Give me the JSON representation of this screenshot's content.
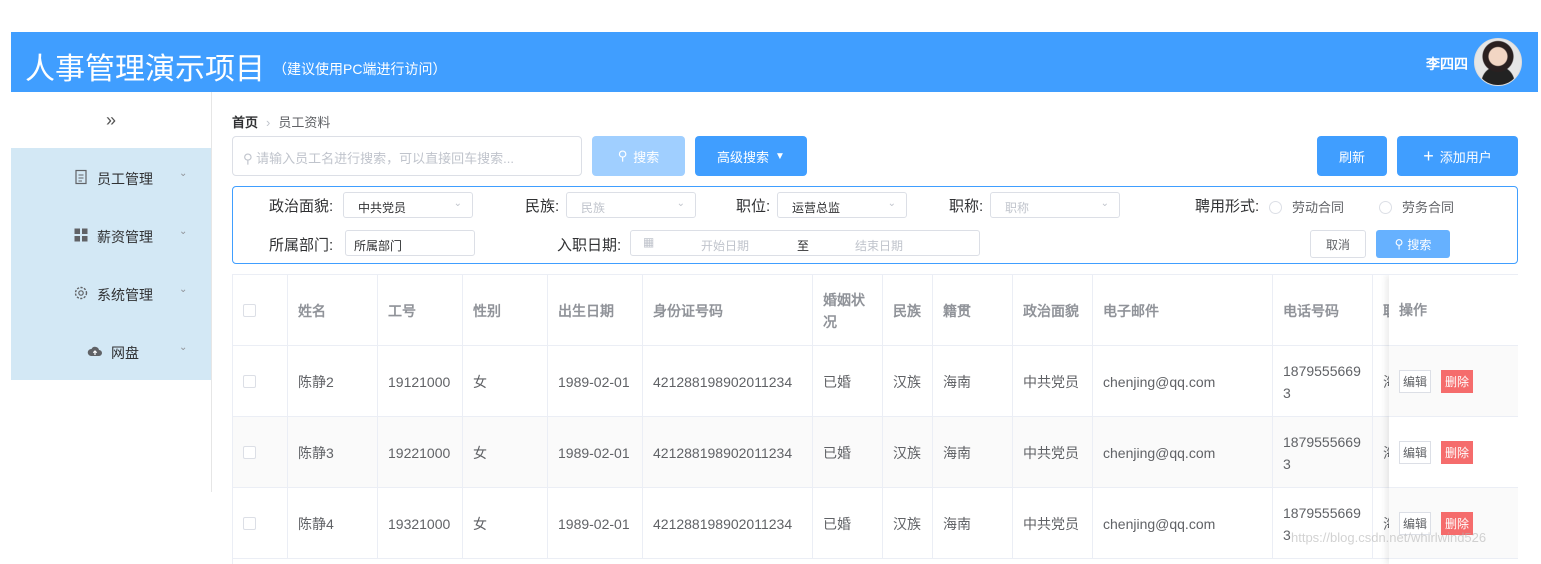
{
  "header": {
    "title": "人事管理演示项目",
    "subtitle": "（建议使用PC端进行访问）",
    "user_name": "李四四",
    "background_color": "#409eff"
  },
  "sidebar": {
    "collapse_icon": "»",
    "items": [
      {
        "label": "员工管理",
        "icon": "document-icon"
      },
      {
        "label": "薪资管理",
        "icon": "grid-icon"
      },
      {
        "label": "系统管理",
        "icon": "gear-icon"
      },
      {
        "label": "网盘",
        "icon": "cloud-upload-icon"
      }
    ]
  },
  "breadcrumb": {
    "home": "首页",
    "current": "员工资料"
  },
  "toolbar": {
    "search_placeholder": "请输入员工名进行搜索，可以直接回车搜索...",
    "search_label": "搜索",
    "advanced_label": "高级搜索",
    "refresh_label": "刷新",
    "add_user_label": "添加用户"
  },
  "filters": {
    "political_label": "政治面貌:",
    "political_value": "中共党员",
    "nation_label": "民族:",
    "nation_placeholder": "民族",
    "position_label": "职位:",
    "position_value": "运营总监",
    "title_label": "职称:",
    "title_placeholder": "职称",
    "hire_type_label": "聘用形式:",
    "hire_option_1": "劳动合同",
    "hire_option_2": "劳务合同",
    "department_label": "所属部门:",
    "department_placeholder": "所属部门",
    "hire_date_label": "入职日期:",
    "start_date_placeholder": "开始日期",
    "range_separator": "至",
    "end_date_placeholder": "结束日期",
    "cancel_label": "取消",
    "search_label": "搜索"
  },
  "table": {
    "columns": [
      "姓名",
      "工号",
      "性别",
      "出生日期",
      "身份证号码",
      "婚姻状况",
      "民族",
      "籍贯",
      "政治面貌",
      "电子邮件",
      "电话号码",
      "职"
    ],
    "operation_header": "操作",
    "edit_label": "编辑",
    "delete_label": "删除",
    "rows": [
      {
        "name": "陈静2",
        "id": "19121000",
        "gender": "女",
        "birth": "1989-02-01",
        "id_card": "421288198902011234",
        "marital": "已婚",
        "nation": "汉族",
        "native": "海南",
        "political": "中共党员",
        "email": "chenjing@qq.com",
        "phone": "18795556693",
        "partial": "海"
      },
      {
        "name": "陈静3",
        "id": "19221000",
        "gender": "女",
        "birth": "1989-02-01",
        "id_card": "421288198902011234",
        "marital": "已婚",
        "nation": "汉族",
        "native": "海南",
        "political": "中共党员",
        "email": "chenjing@qq.com",
        "phone": "18795556693",
        "partial": "海"
      },
      {
        "name": "陈静4",
        "id": "19321000",
        "gender": "女",
        "birth": "1989-02-01",
        "id_card": "421288198902011234",
        "marital": "已婚",
        "nation": "汉族",
        "native": "海南",
        "political": "中共党员",
        "email": "chenjing@qq.com",
        "phone": "18795556693",
        "partial": "海"
      }
    ]
  },
  "watermark": "https://blog.csdn.net/whirlwind526"
}
